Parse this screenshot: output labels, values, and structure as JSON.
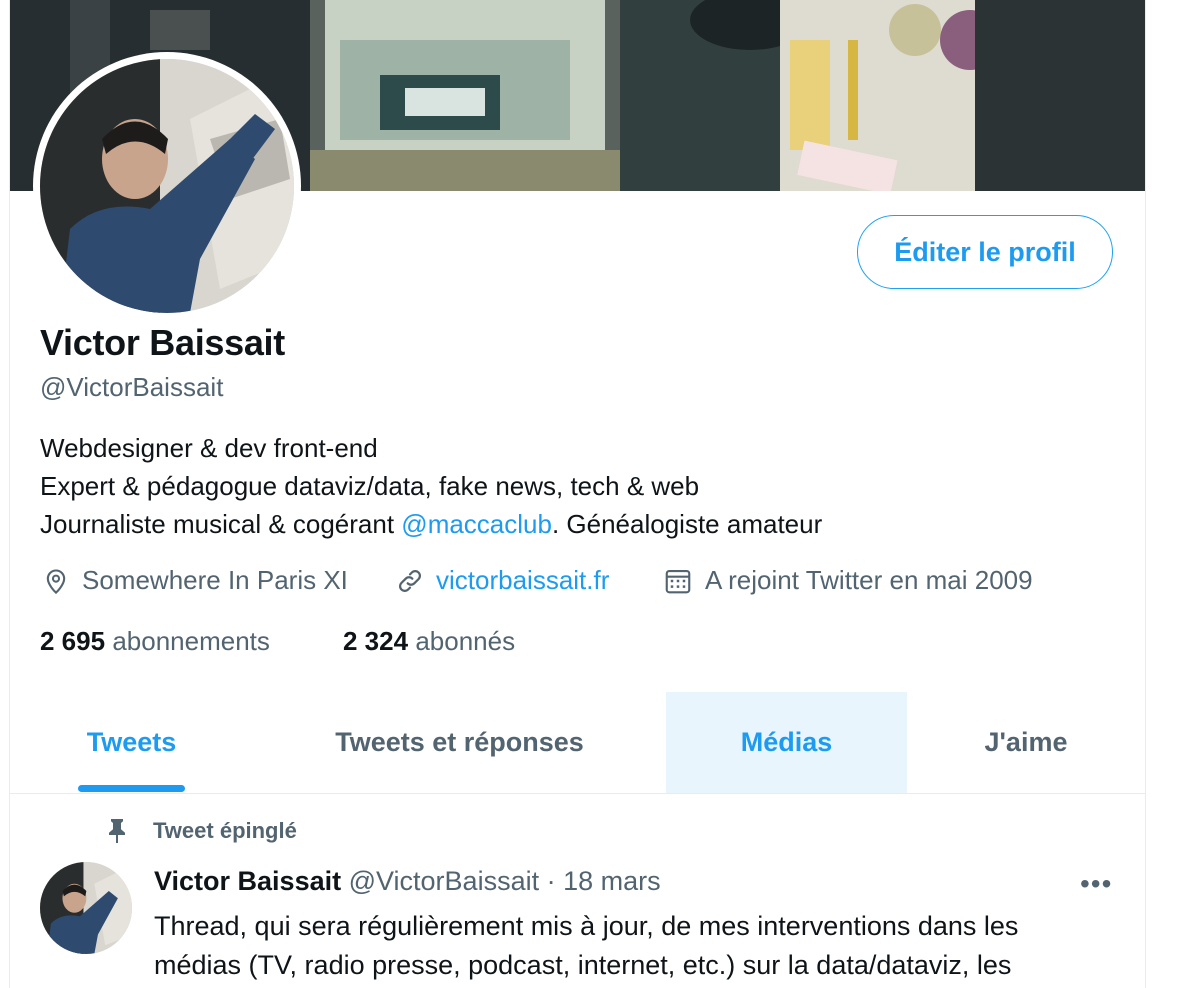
{
  "profile": {
    "name": "Victor Baissait",
    "handle": "@VictorBaissait",
    "edit_button": "Éditer le profil",
    "bio": {
      "line1": "Webdesigner & dev front-end",
      "line2": "Expert & pédagogue dataviz/data, fake news, tech & web",
      "line3_before": "Journaliste musical & cogérant ",
      "line3_mention": "@maccaclub",
      "line3_after": ". Généalogiste amateur"
    },
    "location": "Somewhere In Paris XI",
    "website": "victorbaissait.fr",
    "joined": "A rejoint Twitter en mai 2009",
    "following_count": "2 695",
    "following_label": "abonnements",
    "followers_count": "2 324",
    "followers_label": "abonnés"
  },
  "tabs": [
    {
      "label": "Tweets",
      "state": "active"
    },
    {
      "label": "Tweets et réponses",
      "state": "normal"
    },
    {
      "label": "Médias",
      "state": "hover"
    },
    {
      "label": "J'aime",
      "state": "normal"
    }
  ],
  "pinned_tweet": {
    "pinned_label": "Tweet épinglé",
    "author_name": "Victor Baissait",
    "author_handle": "@VictorBaissait",
    "separator": "·",
    "date": "18 mars",
    "more": "•••",
    "text_line1": "Thread, qui sera régulièrement mis à jour, de mes interventions dans les",
    "text_line2": "médias (TV, radio presse, podcast, internet, etc.) sur la data/dataviz, les"
  },
  "colors": {
    "accent": "#1d9bf0",
    "secondary_text": "#536471",
    "primary_text": "#0f1419",
    "tab_hover_bg": "#e8f5fd"
  },
  "icons": [
    "location-pin-icon",
    "link-icon",
    "calendar-icon",
    "pin-icon",
    "more-icon"
  ]
}
